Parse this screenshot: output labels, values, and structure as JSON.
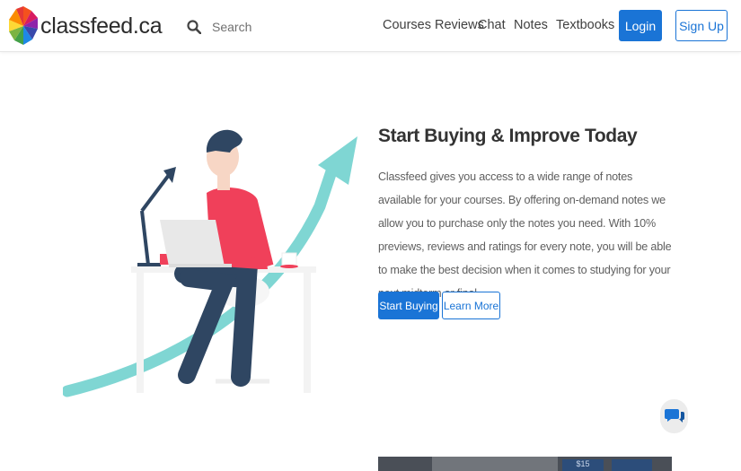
{
  "brand": {
    "name": "classfeed.ca"
  },
  "search": {
    "placeholder": "Search"
  },
  "nav": {
    "links": [
      "Courses Reviews",
      "Chat",
      "Notes",
      "Textbooks"
    ],
    "login_label": "Login",
    "signup_label": "Sign Up"
  },
  "hero": {
    "title": "Start Buying & Improve Today",
    "body": "Classfeed gives you access to a wide range of notes available for your courses. By offering on-demand notes we allow you to purchase only the notes you need. With 10% previews, reviews and ratings for every note, you will be able to make the best decision when it comes to studying for your next midterm or final.",
    "primary_button": "Start Buying",
    "secondary_button": "Learn More"
  },
  "video": {
    "price_label": "$15"
  },
  "colors": {
    "accent": "#1a74d6",
    "arrow": "#7fd6d3",
    "shirt": "#f0405a",
    "pants": "#2f4662"
  },
  "icons": {
    "logo": "classfeed-logo-icon",
    "search": "search-icon",
    "chat": "chat-bubbles-icon"
  }
}
